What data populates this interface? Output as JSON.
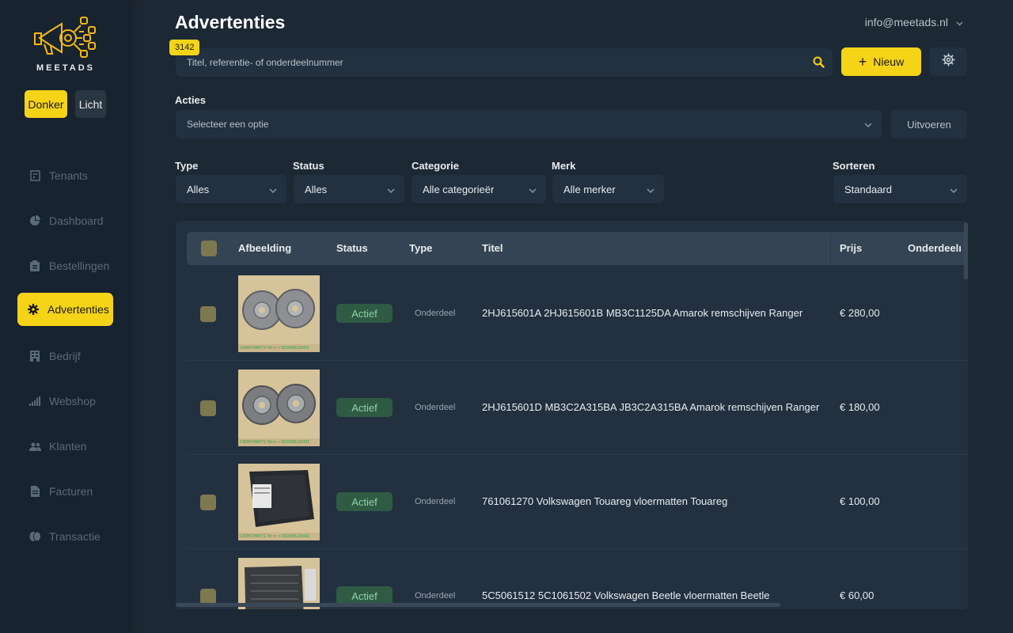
{
  "brand": {
    "name": "MEETADS"
  },
  "theme": {
    "dark_label": "Donker",
    "light_label": "Licht",
    "accent": "#f5d316"
  },
  "sidebar": {
    "items": [
      {
        "label": "Tenants",
        "icon": "building-icon"
      },
      {
        "label": "Dashboard",
        "icon": "pie-chart-icon"
      },
      {
        "label": "Bestellingen",
        "icon": "clipboard-icon"
      },
      {
        "label": "Advertenties",
        "icon": "gear-icon",
        "active": true
      },
      {
        "label": "Bedrijf",
        "icon": "office-icon"
      },
      {
        "label": "Webshop",
        "icon": "bar-signal-icon"
      },
      {
        "label": "Klanten",
        "icon": "people-icon"
      },
      {
        "label": "Facturen",
        "icon": "document-icon"
      },
      {
        "label": "Transactie",
        "icon": "coins-icon"
      }
    ]
  },
  "header": {
    "title": "Advertenties",
    "user_email": "info@meetads.nl"
  },
  "search": {
    "placeholder": "Titel, referentie- of onderdeelnummer",
    "count": "3142"
  },
  "toolbar": {
    "new_label": "Nieuw"
  },
  "actions": {
    "label": "Acties",
    "placeholder": "Selecteer een optie",
    "run_label": "Uitvoeren"
  },
  "filters": {
    "type": {
      "label": "Type",
      "value": "Alles"
    },
    "status": {
      "label": "Status",
      "value": "Alles"
    },
    "category": {
      "label": "Categorie",
      "value": "Alle categorieër"
    },
    "brand": {
      "label": "Merk",
      "value": "Alle merker"
    },
    "sort": {
      "label": "Sorteren",
      "value": "Standaard"
    }
  },
  "table": {
    "columns": [
      "Afbeelding",
      "Status",
      "Type",
      "Titel",
      "Prijs",
      "Onderdeelı"
    ],
    "rows": [
      {
        "status": "Actief",
        "type": "Onderdeel",
        "title": "2HJ615601A 2HJ615601B MB3C1125DA Amarok remschijven Ranger",
        "price": "€ 280,00",
        "thumb_caption": "CARATPARTS Tel nr + 0032485135431"
      },
      {
        "status": "Actief",
        "type": "Onderdeel",
        "title": "2HJ615601D MB3C2A315BA JB3C2A315BA Amarok remschijven Ranger",
        "price": "€ 180,00",
        "thumb_caption": "CARATPARTS Tel nr + 0032485135431"
      },
      {
        "status": "Actief",
        "type": "Onderdeel",
        "title": "761061270 Volkswagen Touareg vloermatten Touareg",
        "price": "€ 100,00",
        "thumb_caption": "CARATPARTS Tel nr + 0032485135431"
      },
      {
        "status": "Actief",
        "type": "Onderdeel",
        "title": "5C5061512 5C1061502 Volkswagen Beetle vloermatten Beetle",
        "price": "€ 60,00",
        "thumb_caption": ""
      }
    ]
  }
}
